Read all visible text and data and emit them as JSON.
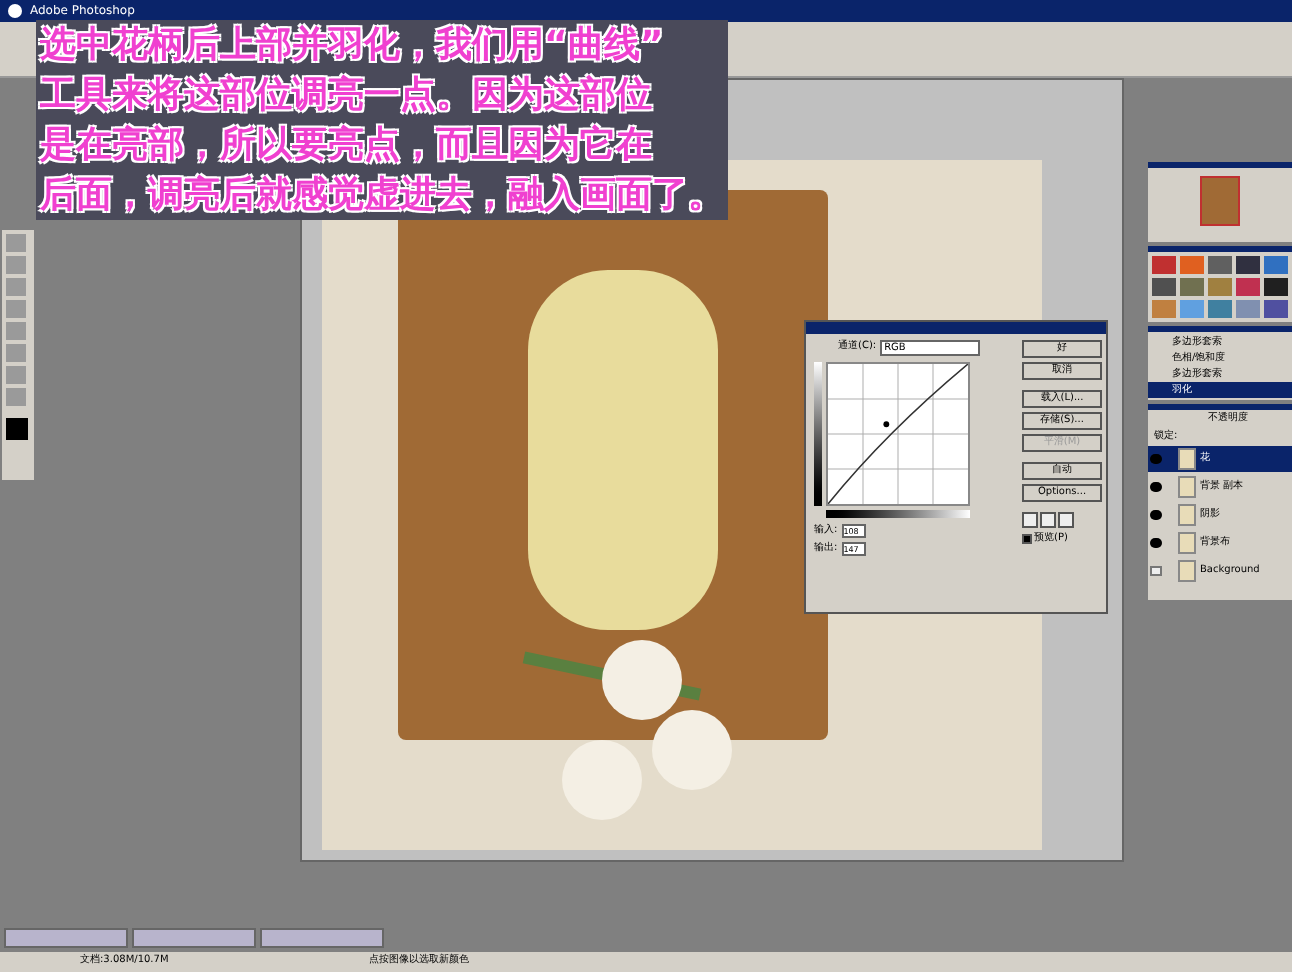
{
  "window": {
    "title": "Adobe Photoshop"
  },
  "caption": [
    "选中花柄后上部并羽化，我们用“曲线”",
    "工具来将这部位调亮一点。因为这部位",
    "是在亮部，所以要亮点，而且因为它在",
    "后面，调亮后就感觉虚进去，融入画面了。"
  ],
  "curves_dialog": {
    "channel_label": "通道(C):",
    "channel": "RGB",
    "input_label": "输入:",
    "input": "108",
    "output_label": "输出:",
    "output": "147",
    "preview": {
      "label": "预览(P)",
      "checked": true
    },
    "buttons": [
      {
        "label": "好",
        "disabled": false
      },
      {
        "label": "取消",
        "disabled": false
      },
      {
        "label": "载入(L)...",
        "disabled": false
      },
      {
        "label": "存储(S)...",
        "disabled": false
      },
      {
        "label": "平滑(M)",
        "disabled": true
      },
      {
        "label": "自动",
        "disabled": false
      },
      {
        "label": "Options...",
        "disabled": false
      }
    ]
  },
  "history": [
    {
      "label": "多边形套索",
      "selected": false
    },
    {
      "label": "色相/饱和度",
      "selected": false
    },
    {
      "label": "多边形套索",
      "selected": false
    },
    {
      "label": "羽化",
      "selected": true
    }
  ],
  "layers": {
    "opacity_label": "不透明度",
    "lock_label": "锁定:",
    "items": [
      {
        "name": "花",
        "visible": true,
        "selected": true
      },
      {
        "name": "背景 副本",
        "visible": true,
        "selected": false
      },
      {
        "name": "阴影",
        "visible": true,
        "selected": false
      },
      {
        "name": "背景布",
        "visible": true,
        "selected": false
      },
      {
        "name": "Background",
        "visible": false,
        "selected": false
      }
    ]
  },
  "status_bar": {
    "document": "文档:3.08M/10.7M",
    "hint": "点按图像以选取新颜色"
  }
}
